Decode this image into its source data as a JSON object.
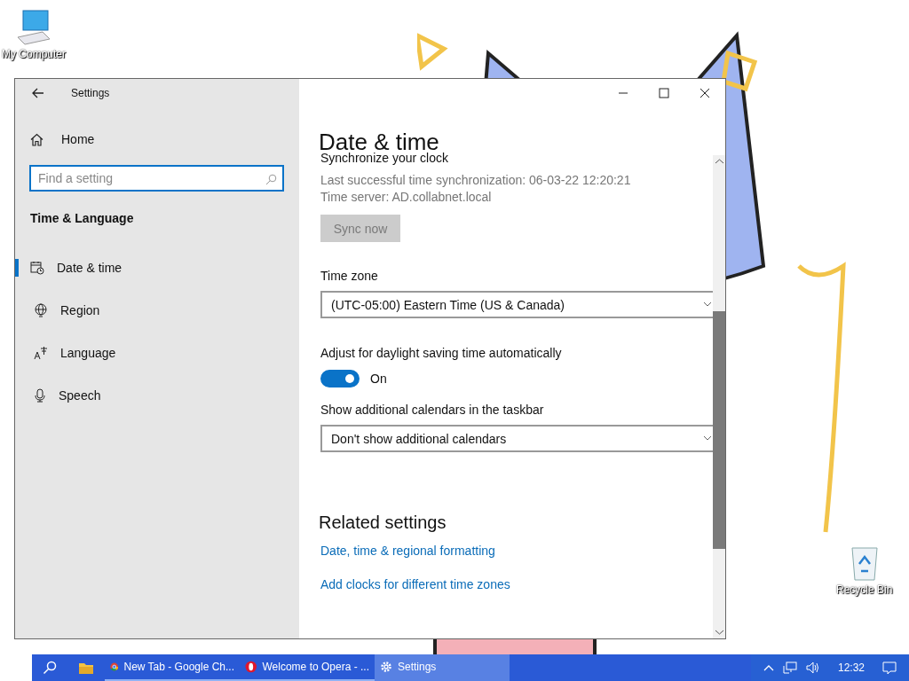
{
  "desktop_icons": [
    {
      "label": "My Computer",
      "kind": "computer"
    },
    {
      "label": "Recycle Bin",
      "kind": "recycle"
    }
  ],
  "window": {
    "title": "Settings",
    "home": "Home",
    "search": {
      "placeholder": "Find a setting"
    },
    "section": "Time & Language",
    "nav": [
      {
        "label": "Date & time",
        "kind": "calendar",
        "selected": true
      },
      {
        "label": "Region",
        "kind": "globe",
        "selected": false
      },
      {
        "label": "Language",
        "kind": "language",
        "selected": false
      },
      {
        "label": "Speech",
        "kind": "microphone",
        "selected": false
      }
    ]
  },
  "page": {
    "title": "Date & time",
    "sync": {
      "heading": "Synchronize your clock",
      "last": "Last successful time synchronization: 06-03-22 12:20:21",
      "server": "Time server: AD.collabnet.local",
      "button": "Sync now",
      "disabled": true
    },
    "time_zone": {
      "label": "Time zone",
      "value": "(UTC-05:00) Eastern Time (US & Canada)"
    },
    "dst": {
      "label": "Adjust for daylight saving time automatically",
      "on": true,
      "state": "On"
    },
    "calendars": {
      "label": "Show additional calendars in the taskbar",
      "value": "Don't show additional calendars"
    },
    "related": {
      "title": "Related settings",
      "links": [
        "Date, time & regional formatting",
        "Add clocks for different time zones"
      ]
    }
  },
  "taskbar": {
    "items": [
      {
        "label": "New Tab - Google Ch...",
        "kind": "chrome",
        "selected": false
      },
      {
        "label": "Welcome to Opera - ...",
        "kind": "opera",
        "selected": false
      },
      {
        "label": "Settings",
        "kind": "gear",
        "selected": true
      }
    ],
    "clock": "12:32"
  }
}
